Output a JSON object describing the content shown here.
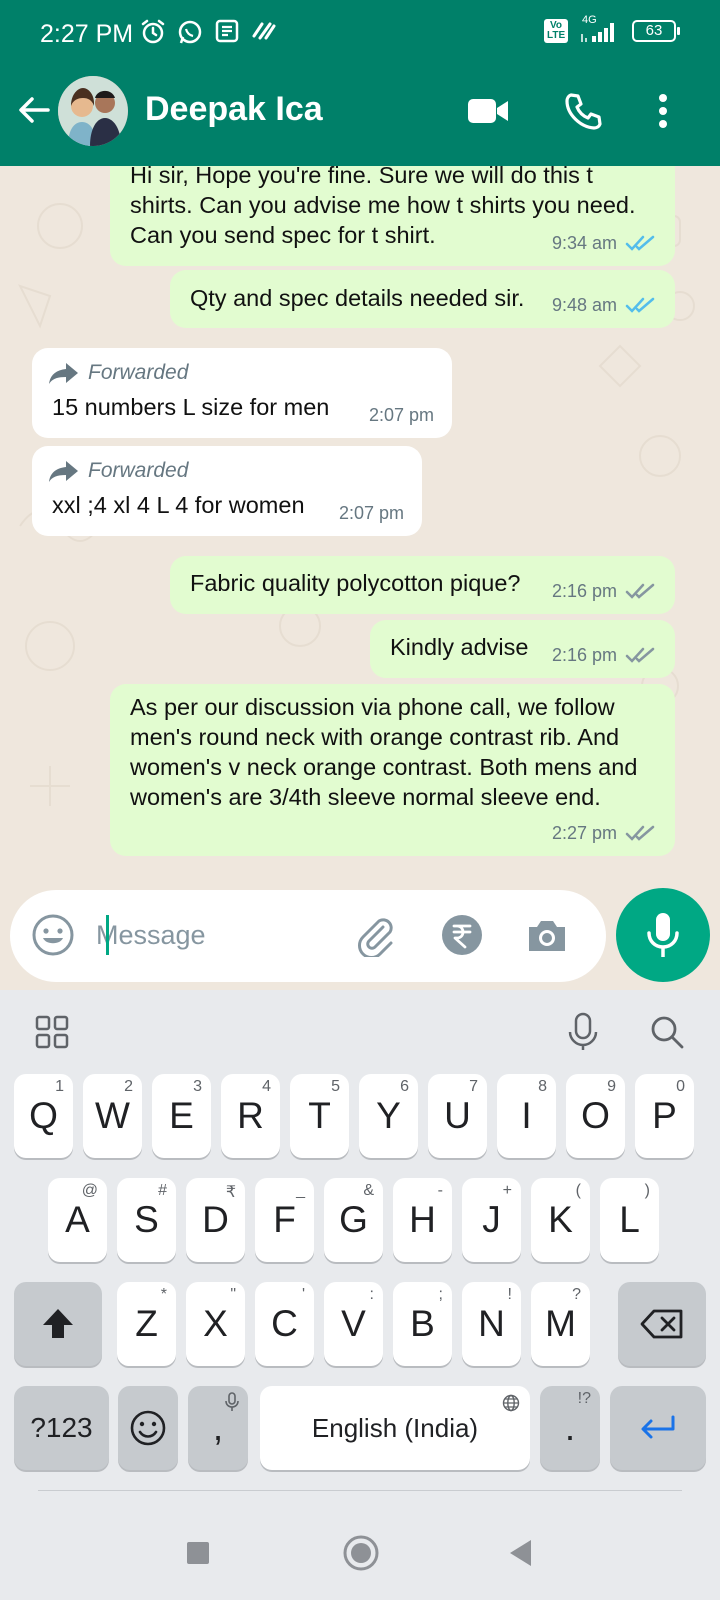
{
  "status_bar": {
    "time": "2:27 PM",
    "network": "4G",
    "volte": "Vo LTE",
    "battery": "63"
  },
  "header": {
    "contact_name": "Deepak Ica"
  },
  "messages": [
    {
      "direction": "out",
      "text": "Hi sir, Hope you're fine. Sure we will do this t shirts. Can you advise me how t shirts you need. Can you send spec for t shirt.",
      "time": "9:34 am",
      "status": "read"
    },
    {
      "direction": "out",
      "text": "Qty and spec details needed sir.",
      "time": "9:48 am",
      "status": "read"
    },
    {
      "direction": "in",
      "forwarded_label": "Forwarded",
      "text": "15 numbers L size for men",
      "time": "2:07 pm"
    },
    {
      "direction": "in",
      "forwarded_label": "Forwarded",
      "text": "xxl ;4 xl 4 L 4 for women",
      "time": "2:07 pm"
    },
    {
      "direction": "out",
      "text": "Fabric quality polycotton pique?",
      "time": "2:16 pm",
      "status": "delivered"
    },
    {
      "direction": "out",
      "text": "Kindly advise",
      "time": "2:16 pm",
      "status": "delivered"
    },
    {
      "direction": "out",
      "text": "As per our discussion via phone call, we follow men's round neck with orange contrast rib. And women's v neck orange contrast. Both mens and women's are 3/4th sleeve normal sleeve end.",
      "time": "2:27 pm",
      "status": "delivered"
    }
  ],
  "composer": {
    "placeholder": "Message"
  },
  "keyboard": {
    "row1": [
      {
        "k": "Q",
        "h": "1"
      },
      {
        "k": "W",
        "h": "2"
      },
      {
        "k": "E",
        "h": "3"
      },
      {
        "k": "R",
        "h": "4"
      },
      {
        "k": "T",
        "h": "5"
      },
      {
        "k": "Y",
        "h": "6"
      },
      {
        "k": "U",
        "h": "7"
      },
      {
        "k": "I",
        "h": "8"
      },
      {
        "k": "O",
        "h": "9"
      },
      {
        "k": "P",
        "h": "0"
      }
    ],
    "row2": [
      {
        "k": "A",
        "h": "@"
      },
      {
        "k": "S",
        "h": "#"
      },
      {
        "k": "D",
        "h": "₹"
      },
      {
        "k": "F",
        "h": "_"
      },
      {
        "k": "G",
        "h": "&"
      },
      {
        "k": "H",
        "h": "-"
      },
      {
        "k": "J",
        "h": "+"
      },
      {
        "k": "K",
        "h": "("
      },
      {
        "k": "L",
        "h": ")"
      }
    ],
    "row3": [
      {
        "k": "Z",
        "h": "*"
      },
      {
        "k": "X",
        "h": "\""
      },
      {
        "k": "C",
        "h": "'"
      },
      {
        "k": "V",
        "h": ":"
      },
      {
        "k": "B",
        "h": ";"
      },
      {
        "k": "N",
        "h": "!"
      },
      {
        "k": "M",
        "h": "?"
      }
    ],
    "symbols_key": "?123",
    "comma_key": ",",
    "space_label": "English (India)",
    "period_key": ".",
    "period_hint": "!?"
  },
  "colors": {
    "header": "#008069",
    "accent": "#00a884",
    "outgoing_bubble": "#e2fcd0",
    "read_ticks": "#53bdeb"
  }
}
